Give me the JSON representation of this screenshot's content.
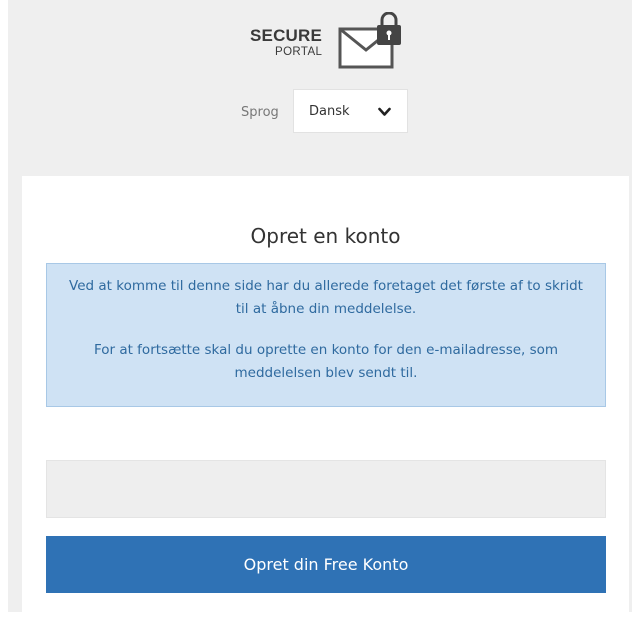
{
  "logo": {
    "line1": "SECURE",
    "line2": "PORTAL"
  },
  "language": {
    "label": "Sprog",
    "selected": "Dansk"
  },
  "card": {
    "title": "Opret en konto",
    "info_paragraph_1": "Ved at komme til denne side har du allerede foretaget det første af to skridt til at åbne din meddelelse.",
    "info_paragraph_2": "For at fortsætte skal du oprette en konto for den e-mailadresse, som meddelelsen blev sendt til.",
    "email_value": "",
    "submit_label": "Opret din Free Konto"
  },
  "colors": {
    "accent": "#2f72b5",
    "info_bg": "#cfe2f4",
    "info_text": "#2f6a9f"
  }
}
